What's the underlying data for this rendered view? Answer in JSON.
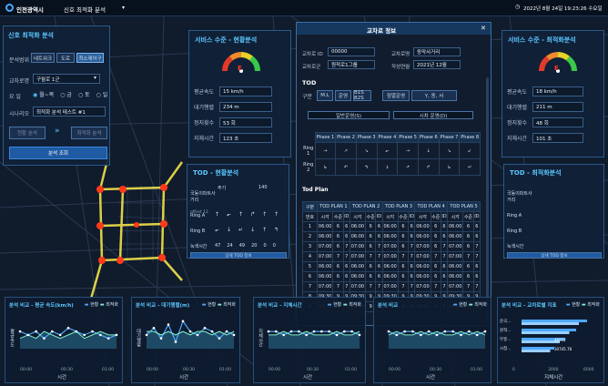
{
  "topbar": {
    "logo": "인천광역시",
    "title": "신호 최적화 분석",
    "datetime": "2022년 8월 24일 19:23:26 수요일"
  },
  "left_panel": {
    "title": "신호 최적화 분석",
    "range_label": "분석범위",
    "range_tabs": [
      "네트워크",
      "도로",
      "최소제어구"
    ],
    "control_label": "교차로명",
    "control_value": "구월로 1군",
    "day_label": "요 일",
    "days": [
      "월~목",
      "금",
      "토",
      "일"
    ],
    "scenario_label": "시나리오",
    "scenario_value": "최적화 분석 테스트 #1",
    "current_btn": "현황 분석",
    "optimize_btn": "최적화 분석",
    "query_btn": "분석 조회"
  },
  "service_current": {
    "title": "서비스 수준 - 현황분석",
    "grade": "E",
    "rows": [
      {
        "label": "평균속도",
        "value": "15 km/h"
      },
      {
        "label": "대기행렬",
        "value": "234 m"
      },
      {
        "label": "정지횟수",
        "value": "53 회"
      },
      {
        "label": "지체시간",
        "value": "123 초"
      }
    ]
  },
  "service_opt": {
    "title": "서비스 수준 - 최적화분석",
    "grade": "E",
    "rows": [
      {
        "label": "평균속도",
        "value": "18 km/h"
      },
      {
        "label": "대기행렬",
        "value": "211 m"
      },
      {
        "label": "정지횟수",
        "value": "48 회"
      },
      {
        "label": "지체시간",
        "value": "101 초"
      }
    ]
  },
  "tod_current": {
    "title": "TOD - 현황분석",
    "row1": "국동이파트사거리",
    "period": "주기",
    "period_val": "140",
    "offset": "offset 12",
    "ringA": "Ring A",
    "ringB": "Ring B",
    "green": "녹색시간",
    "green_vals": [
      "47",
      "24",
      "49",
      "20",
      "0",
      "0"
    ],
    "detail": "상세 TOD 정보"
  },
  "tod_opt": {
    "title": "TOD - 최적화분석",
    "row1": "국동이파트사거리",
    "period": "주기",
    "ringA": "Ring A",
    "ringB": "Ring B",
    "green": "녹색시간",
    "detail": "상세 TOD 정보"
  },
  "modal": {
    "title": "교차로 정보",
    "close": "✕",
    "id_label": "교차로 ID",
    "id_value": "00000",
    "name_label": "교차로명",
    "name_value": "동막사거리",
    "group_label": "교차로군",
    "group_value": "원적로1그룹",
    "date_label": "작성연월",
    "date_value": "2021년 12월",
    "tod_label": "TOD",
    "type_label": "구분",
    "type_opts": [
      "M.L",
      "운영",
      "B1S B2S",
      "점멸운영",
      "Y, 동, 서"
    ],
    "sub_btn1": "일반운영(S)",
    "sub_btn2": "시차 운영(D)",
    "phases": [
      "Phase 1",
      "Phase 2",
      "Phase 3",
      "Phase 4",
      "Phase 5",
      "Phase 6",
      "Phase 7",
      "Phase 8"
    ],
    "ring1": "Ring 1",
    "ring2": "Ring 2",
    "ring1_icons": [
      "→",
      "↗",
      "↘",
      "⬐",
      "→",
      "↓",
      "↘",
      "↙"
    ],
    "ring2_icons": [
      "↳",
      "↶",
      "↰",
      "↓",
      "⬏",
      "↱",
      "↳",
      "↵"
    ],
    "plan_title": "Tod Plan",
    "plan_headers": [
      "구분",
      "TOD PLAN 1",
      "TOD PLAN 2",
      "TOD PLAN 3",
      "TOD PLAN 4",
      "TOD PLAN 5"
    ],
    "plan_sub": [
      "번호",
      "시각",
      "수준",
      "ID"
    ],
    "plan_rows": [
      [
        "1",
        "06:00",
        "6",
        "6"
      ],
      [
        "2",
        "06:00",
        "6",
        "6"
      ],
      [
        "3",
        "07:00",
        "6",
        "7"
      ],
      [
        "4",
        "07:00",
        "7",
        "7"
      ],
      [
        "5",
        "06:00",
        "6",
        "6"
      ],
      [
        "6",
        "06:00",
        "6",
        "6"
      ],
      [
        "7",
        "07:00",
        "7",
        "7"
      ],
      [
        "8",
        "09:30",
        "9",
        "9"
      ],
      [
        "9",
        "09:30",
        "9",
        "9"
      ]
    ]
  },
  "bottom_charts": [
    {
      "title": "분석 비교 - 평균 속도(km/h)",
      "legend": [
        "현황",
        "최적화"
      ],
      "xlabel": "시간",
      "ylabel": "평균속도",
      "ticks": [
        "00:00",
        "00:30",
        "01:00"
      ]
    },
    {
      "title": "분석 비교 - 대기행렬(m)",
      "legend": [
        "현황",
        "최적화"
      ],
      "xlabel": "시간",
      "ylabel": "대기행렬",
      "ticks": [
        "00:00",
        "00:30",
        "01:00"
      ]
    },
    {
      "title": "분석 비교 - 지체시간",
      "legend": [
        "현황",
        "최적화"
      ],
      "xlabel": "시간",
      "ylabel": "지체시간",
      "ticks": [
        "00:00",
        "00:30",
        "01:00"
      ]
    },
    {
      "title": "분석 비교",
      "legend": [
        "현황",
        "최적화"
      ],
      "xlabel": "시간",
      "ylabel": "",
      "ticks": [
        "00:00",
        "00:30",
        "01:00"
      ]
    },
    {
      "title": "분석 비교 - 교차로별 지표",
      "legend": [
        "현황",
        "최적화"
      ],
      "xlabel": "지체시간",
      "ylabel": "",
      "ticks": [
        "0",
        "3000",
        "6000"
      ]
    }
  ],
  "bar_chart": {
    "labels": [
      "운곡...",
      "원적...",
      "부흥...",
      "시청..."
    ],
    "values": [
      "",
      "",
      "46912",
      "30745.78"
    ]
  },
  "colors": {
    "accent": "#5cc8ff",
    "current": "#4fa8ff",
    "optimized": "#7ff0c8"
  }
}
